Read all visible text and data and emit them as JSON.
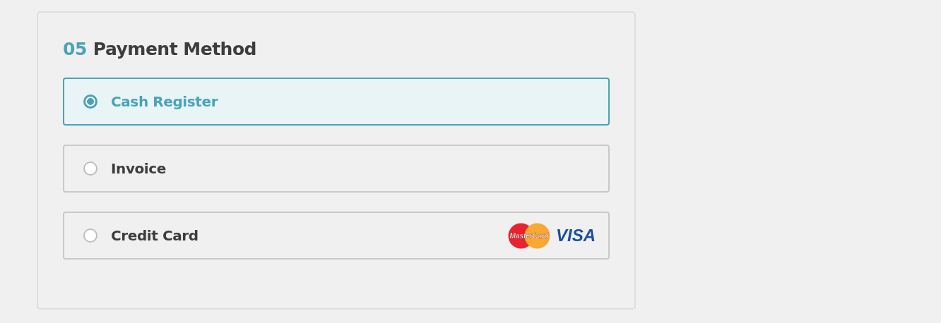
{
  "section": {
    "number": "05",
    "title": "Payment Method"
  },
  "options": [
    {
      "label": "Cash Register",
      "selected": true
    },
    {
      "label": "Invoice",
      "selected": false
    },
    {
      "label": "Credit Card",
      "selected": false,
      "logos": [
        "MasterCard",
        "VISA"
      ]
    }
  ]
}
